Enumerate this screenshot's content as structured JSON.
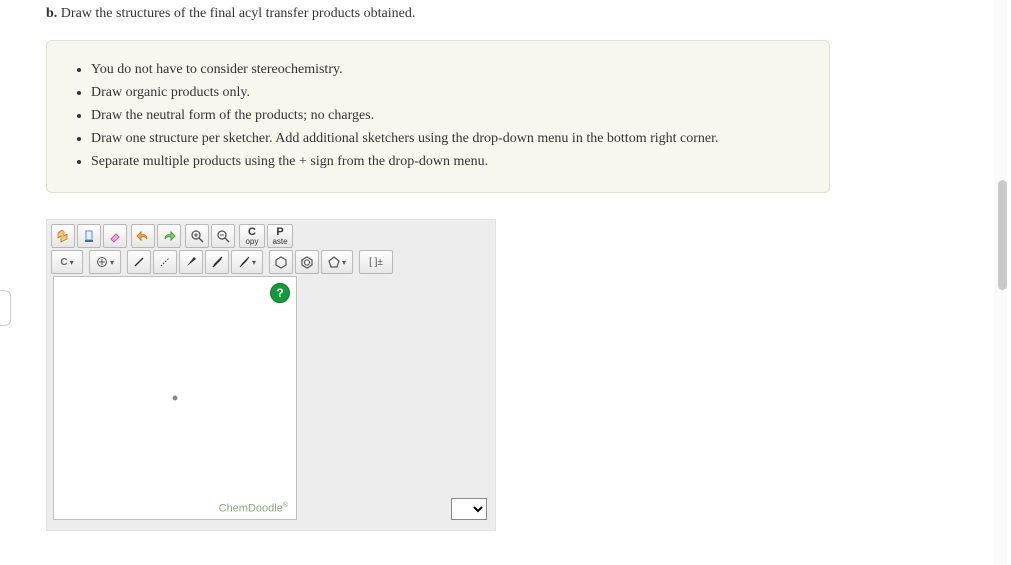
{
  "question": {
    "part": "b.",
    "text": " Draw the structures of the final acyl transfer products obtained."
  },
  "instructions": [
    "You do not have to consider stereochemistry.",
    "Draw organic products only.",
    "Draw the neutral form of the products; no charges.",
    "Draw one structure per sketcher. Add additional sketchers using the drop-down menu in the bottom right corner.",
    "Separate multiple products using the + sign from the drop-down menu."
  ],
  "toolbar": {
    "copy": {
      "big": "C",
      "small": "opy"
    },
    "paste": {
      "big": "P",
      "small": "aste"
    },
    "element": "C",
    "charge_glyph": "[ ]±"
  },
  "brand": "ChemDoodle",
  "help_glyph": "?"
}
